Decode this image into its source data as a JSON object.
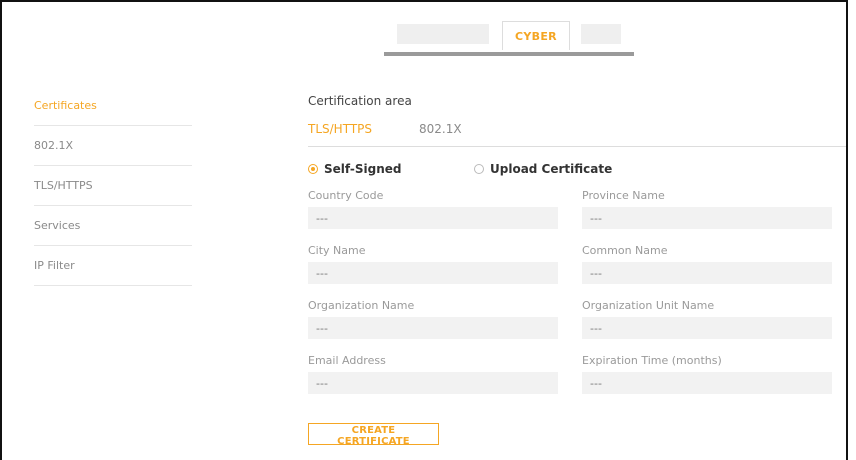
{
  "top_tabs": {
    "active_label": "CYBER"
  },
  "sidebar": {
    "items": [
      {
        "label": "Certificates",
        "active": true
      },
      {
        "label": "802.1X",
        "active": false
      },
      {
        "label": "TLS/HTTPS",
        "active": false
      },
      {
        "label": "Services",
        "active": false
      },
      {
        "label": "IP Filter",
        "active": false
      }
    ]
  },
  "main": {
    "section_title": "Certification area",
    "subtabs": [
      {
        "label": "TLS/HTTPS",
        "active": true
      },
      {
        "label": "802.1X",
        "active": false
      }
    ],
    "radio_options": [
      {
        "label": "Self-Signed",
        "selected": true
      },
      {
        "label": "Upload Certificate",
        "selected": false
      }
    ],
    "fields": {
      "country_code": {
        "label": "Country Code",
        "placeholder": "---"
      },
      "province_name": {
        "label": "Province Name",
        "placeholder": "---"
      },
      "city_name": {
        "label": "City Name",
        "placeholder": "---"
      },
      "common_name": {
        "label": "Common Name",
        "placeholder": "---"
      },
      "organization_name": {
        "label": "Organization Name",
        "placeholder": "---"
      },
      "organization_unit_name": {
        "label": "Organization Unit Name",
        "placeholder": "---"
      },
      "email_address": {
        "label": "Email Address",
        "placeholder": "---"
      },
      "expiration_time": {
        "label": "Expiration Time (months)",
        "placeholder": "---"
      }
    },
    "create_button_label": "CREATE CERTIFICATE"
  },
  "colors": {
    "accent": "#f5a623",
    "muted_text": "#8a8a8a",
    "input_bg": "#f2f2f2"
  }
}
